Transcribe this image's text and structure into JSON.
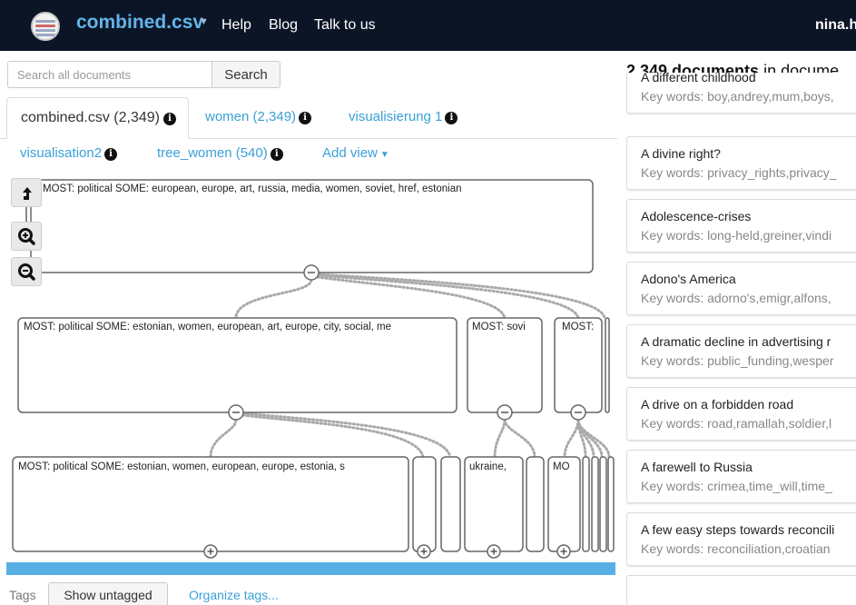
{
  "navbar": {
    "document_title": "combined.csv",
    "links": {
      "help": "Help",
      "blog": "Blog",
      "talk": "Talk to us"
    },
    "user": "nina.h"
  },
  "search": {
    "placeholder": "Search all documents",
    "button": "Search"
  },
  "tabs": {
    "active": "combined.csv (2,349)",
    "women": "women (2,349)",
    "visualisierung": "visualisierung 1",
    "viz2": "visualisation2",
    "tree": "tree_women (540)",
    "add_view": "Add view"
  },
  "tree": {
    "root": "MOST: political  SOME: european, europe, art, russia, media, women, soviet, href, estonian",
    "level1": [
      "MOST: political  SOME: estonian, women, european, art, europe, city, social, me",
      "MOST: sovi",
      "MOST:"
    ],
    "level2": [
      "MOST: political  SOME: estonian, women, european, europe, estonia, s",
      "ukraine,",
      "MO"
    ]
  },
  "tags": {
    "label": "Tags",
    "show_untagged": "Show untagged",
    "organize": "Organize tags..."
  },
  "documents": {
    "count": "2,349 documents",
    "count_suffix": " in docume",
    "items": [
      {
        "title": "A different childhood",
        "keywords": "Key words: boy,andrey,mum,boys,"
      },
      {
        "title": "A divine right?",
        "keywords": "Key words: privacy_rights,privacy_"
      },
      {
        "title": "Adolescence-crises",
        "keywords": "Key words: long-held,greiner,vindi"
      },
      {
        "title": "Adono's America",
        "keywords": "Key words: adorno's,emigr,alfons,"
      },
      {
        "title": "A dramatic decline in advertising r",
        "keywords": "Key words: public_funding,wesper"
      },
      {
        "title": "A drive on a forbidden road",
        "keywords": "Key words: road,ramallah,soldier,l"
      },
      {
        "title": "A farewell to Russia",
        "keywords": "Key words: crimea,time_will,time_"
      },
      {
        "title": "A few easy steps towards reconcili",
        "keywords": "Key words: reconciliation,croatian"
      }
    ]
  },
  "colors": {
    "navbar": "#0b1526",
    "title_accent": "#63b4e8",
    "link": "#3aa0d8",
    "bar": "#5aaee6"
  },
  "icons": [
    "logo-icon",
    "info-icon",
    "caret-down-icon",
    "up-arrow-icon",
    "zoom-in-icon",
    "zoom-out-icon",
    "collapse-icon",
    "expand-icon"
  ]
}
